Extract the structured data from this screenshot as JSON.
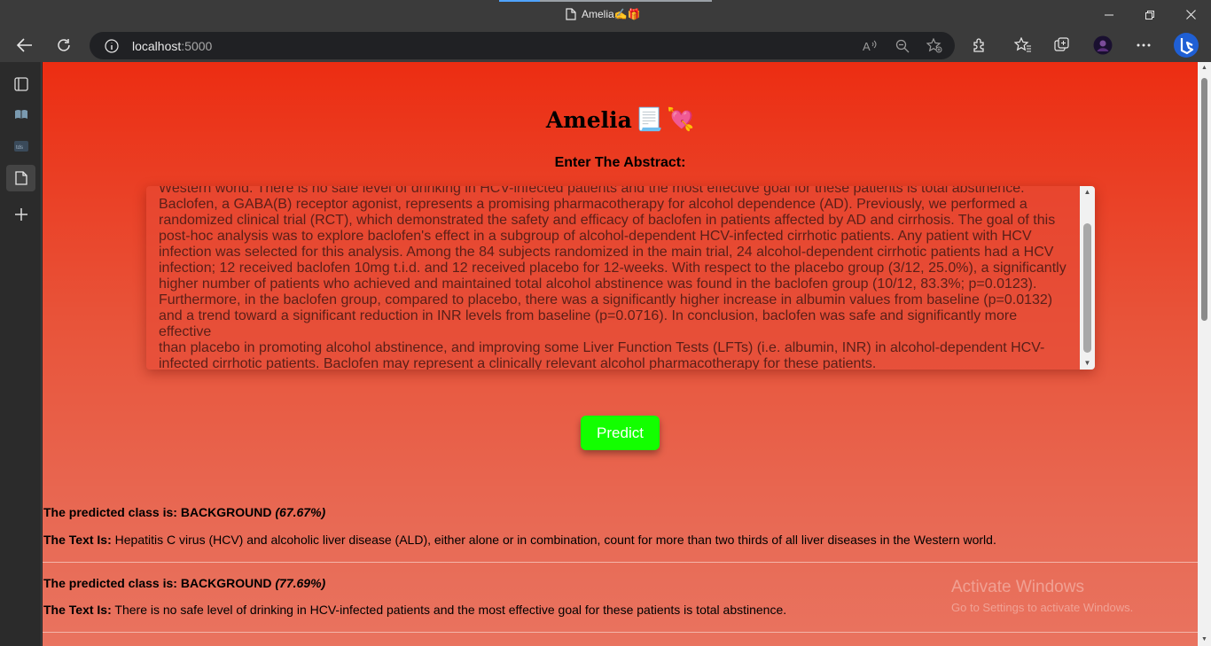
{
  "browser": {
    "tab_title": "Amelia✍️🎁",
    "url_host": "localhost",
    "url_port": ":5000"
  },
  "page": {
    "title": "Amelia",
    "title_emoji_1": "📃",
    "title_emoji_2": "💘",
    "abstract_label": "Enter The Abstract:",
    "abstract_lines": [
      "Western world. There is no safe level of drinking in HCV-infected patients and the most effective goal for these patients is total abstinence.",
      "Baclofen, a GABA(B) receptor agonist, represents a promising pharmacotherapy for alcohol dependence (AD). Previously, we performed a",
      "randomized clinical trial (RCT), which demonstrated the safety and efficacy of baclofen in patients affected by AD and cirrhosis. The goal of this",
      "post-hoc analysis was to explore baclofen's effect in a subgroup of alcohol-dependent HCV-infected cirrhotic patients. Any patient with HCV",
      "infection was selected for this analysis. Among the 84 subjects randomized in the main trial, 24 alcohol-dependent cirrhotic patients had a HCV",
      "infection; 12 received baclofen 10mg t.i.d. and 12 received placebo for 12-weeks. With respect to the placebo group (3/12, 25.0%), a significantly",
      "higher number of patients who achieved and maintained total alcohol abstinence was found in the baclofen group (10/12, 83.3%; p=0.0123).",
      "Furthermore, in the baclofen group, compared to placebo, there was a significantly higher increase in albumin values from baseline (p=0.0132)",
      "and a trend toward a significant reduction in INR levels from baseline (p=0.0716). In conclusion, baclofen was safe and significantly more effective",
      "than placebo in promoting alcohol abstinence, and improving some Liver Function Tests (LFTs) (i.e. albumin, INR) in alcohol-dependent HCV-",
      "infected cirrhotic patients. Baclofen may represent a clinically relevant alcohol pharmacotherapy for these patients."
    ],
    "predict_label": "Predict",
    "results": [
      {
        "class_prefix": "The predicted class is: BACKGROUND",
        "confidence": "(67.67%)",
        "text_label": "The Text Is:",
        "text": "Hepatitis C virus (HCV) and alcoholic liver disease (ALD), either alone or in combination, count for more than two thirds of all liver diseases in the Western world."
      },
      {
        "class_prefix": "The predicted class is: BACKGROUND",
        "confidence": "(77.69%)",
        "text_label": "The Text Is:",
        "text": "There is no safe level of drinking in HCV-infected patients and the most effective goal for these patients is total abstinence."
      }
    ]
  },
  "watermark": {
    "line1": "Activate Windows",
    "line2": "Go to Settings to activate Windows."
  }
}
